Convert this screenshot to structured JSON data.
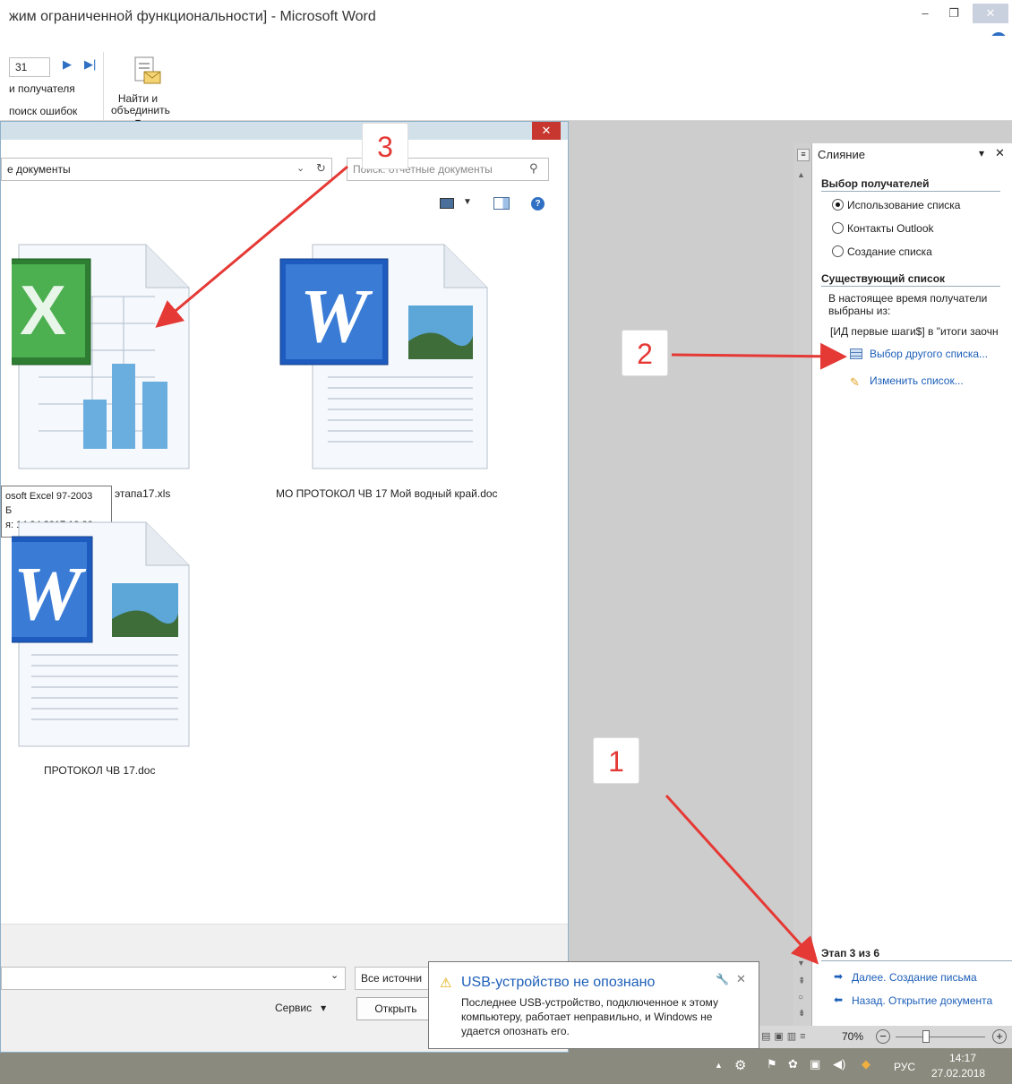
{
  "window": {
    "title": "жим ограниченной функциональности] - Microsoft Word",
    "min_icon": "minimize-icon",
    "max_icon": "restore-icon",
    "close_icon": "close-icon"
  },
  "ribbon": {
    "record_number": "31",
    "find_recipient": "и получателя",
    "check_errors": "поиск ошибок",
    "find_merge_line1": "Найти и",
    "find_merge_line2": "объединить"
  },
  "dialog": {
    "folder_path": "е документы",
    "search_placeholder": "Поиск: отчетные документы",
    "files": [
      {
        "name": "этапа17.xls",
        "type": "excel"
      },
      {
        "name": "МО ПРОТОКОЛ ЧВ 17 Мой водный край.doc",
        "type": "word"
      },
      {
        "name": "ПРОТОКОЛ ЧВ 17.doc",
        "type": "word"
      }
    ],
    "tooltip": {
      "line1": "osoft Excel 97-2003",
      "line2": "Б",
      "line3": "я: 14.04.2017 10:00"
    },
    "filter_value": "Все источни",
    "service_label": "Сервис",
    "open_label": "Открыть"
  },
  "task_pane": {
    "title": "Слияние",
    "select_recipients": "Выбор получателей",
    "options": [
      {
        "label": "Использование списка",
        "checked": true
      },
      {
        "label": "Контакты Outlook",
        "checked": false
      },
      {
        "label": "Создание списка",
        "checked": false
      }
    ],
    "existing_list": "Существующий список",
    "description": "В настоящее время получатели выбраны из:",
    "source": "[ИД первые шаги$] в \"итоги заочн",
    "select_other_list": "Выбор другого списка...",
    "edit_list": "Изменить список...",
    "step": "Этап 3 из 6",
    "next_link": "Далее. Создание письма",
    "back_link": "Назад. Открытие документа"
  },
  "status": {
    "zoom": "70%"
  },
  "taskbar": {
    "language": "РУС",
    "time": "14:17",
    "date": "27.02.2018"
  },
  "notification": {
    "title": "USB-устройство не опознано",
    "body": "Последнее USB-устройство, подключенное к этому компьютеру, работает неправильно, и Windows не удается опознать его."
  },
  "markers": [
    "1",
    "2",
    "3"
  ],
  "colors": {
    "arrow": "#e53935",
    "link": "#1d5fb8",
    "excel_green": "#2e7d32",
    "word_blue": "#1e5bbf"
  }
}
